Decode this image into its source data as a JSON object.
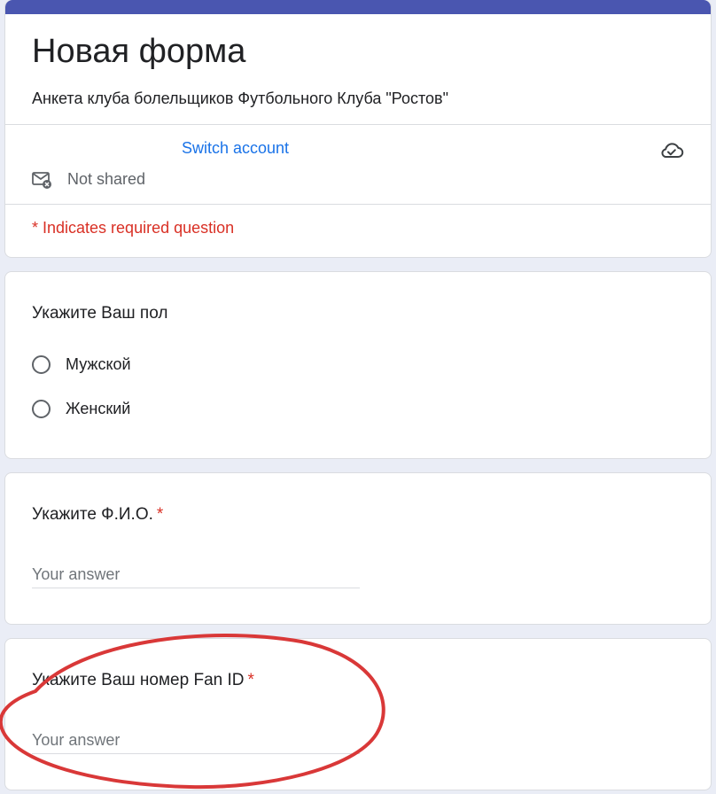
{
  "form": {
    "title": "Новая форма",
    "description": "Анкета клуба болельщиков Футбольного Клуба \"Ростов\"",
    "accent_color": "#4a56b0"
  },
  "account": {
    "switch_label": "Switch account",
    "share_status": "Not shared",
    "icons": [
      "cloud-check-icon",
      "mail-not-shared-icon"
    ]
  },
  "required_note": "* Indicates required question",
  "questions": [
    {
      "title": "Укажите Ваш пол",
      "required": false,
      "options": [
        "Мужской",
        "Женский"
      ]
    },
    {
      "title": "Укажите Ф.И.О.",
      "required": true,
      "placeholder": "Your answer"
    },
    {
      "title": "Укажите Ваш номер Fan ID",
      "required": true,
      "placeholder": "Your answer"
    }
  ],
  "required_marker": "*",
  "annotation_color": "#d93838"
}
